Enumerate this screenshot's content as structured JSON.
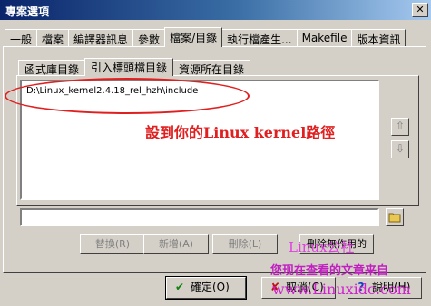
{
  "window": {
    "title": "專案選項",
    "close_glyph": "✕"
  },
  "outer_tabs": [
    {
      "label": "一般",
      "active": false
    },
    {
      "label": "檔案",
      "active": false
    },
    {
      "label": "編譯器訊息",
      "active": false
    },
    {
      "label": "參數",
      "active": false
    },
    {
      "label": "檔案/目錄",
      "active": true
    },
    {
      "label": "執行檔產生...",
      "active": false
    },
    {
      "label": "Makefile",
      "active": false
    },
    {
      "label": "版本資訊",
      "active": false
    }
  ],
  "inner_tabs": [
    {
      "label": "函式庫目錄",
      "active": false
    },
    {
      "label": "引入標頭檔目錄",
      "active": true
    },
    {
      "label": "資源所在目錄",
      "active": false
    }
  ],
  "list": {
    "items": [
      "D:\\Linux_kernel2.4.18_rel_hzh\\include"
    ]
  },
  "annotation": {
    "text": "設到你的Linux kernel路徑",
    "color": "#e02020"
  },
  "side_buttons": {
    "up_glyph": "⇧",
    "down_glyph": "⇩"
  },
  "path_input": {
    "value": ""
  },
  "browse_icon": "folder-icon",
  "actions": {
    "replace": "替換(R)",
    "add": "新增(A)",
    "delete": "刪除(L)",
    "delete_invalid": "刪除無作用的"
  },
  "watermark": {
    "line1": "Linux公社",
    "line2": "您现在查看的文章来自",
    "line3": "www.Linuxidc.com"
  },
  "dialog_buttons": {
    "ok": "確定(O)",
    "cancel": "取消(C)",
    "help": "說明(H)"
  }
}
